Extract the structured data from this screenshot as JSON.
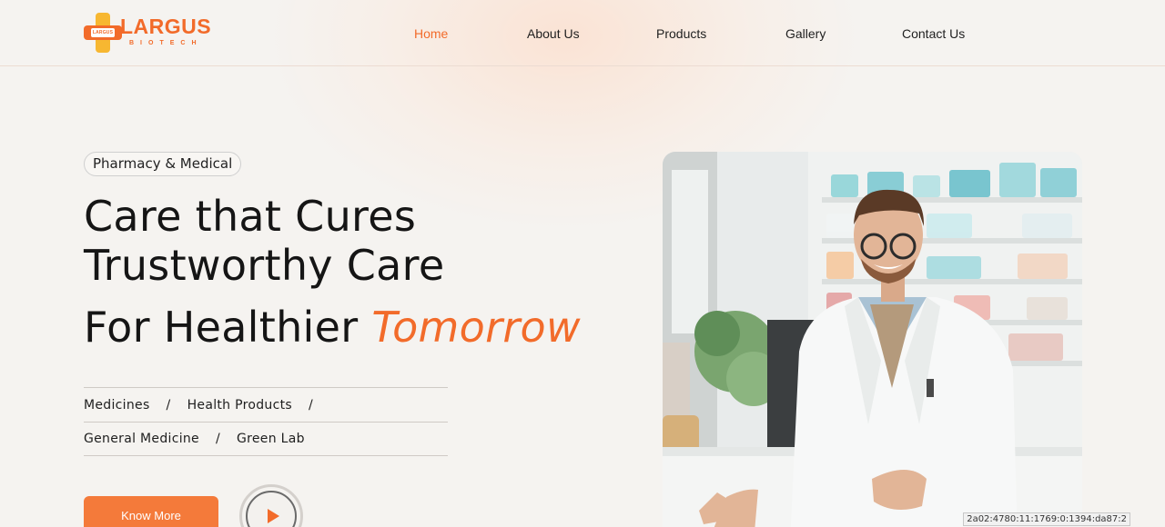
{
  "brand": {
    "name": "LARGUS",
    "subtitle": "BIOTECH",
    "mark_text": "LARGUS",
    "logo_icon": "cross-logo-icon"
  },
  "colors": {
    "accent": "#f26b2a",
    "accent_button": "#f47a3a",
    "logo_secondary": "#f7b731",
    "background": "#f5f3f0"
  },
  "nav": {
    "items": [
      {
        "label": "Home",
        "active": true
      },
      {
        "label": "About Us",
        "active": false
      },
      {
        "label": "Products",
        "active": false
      },
      {
        "label": "Gallery",
        "active": false
      },
      {
        "label": "Contact Us",
        "active": false
      }
    ]
  },
  "hero": {
    "tag": "Pharmacy & Medical",
    "title_line1": "Care that Cures",
    "title_line2": "Trustworthy Care",
    "title_line3_prefix": "For Healthier",
    "title_line3_accent": "Tomorrow",
    "services_row1": [
      "Medicines",
      "Health Products"
    ],
    "services_row2": [
      "General Medicine",
      "Green Lab"
    ],
    "separator": "/",
    "cta_label": "Know More",
    "play_icon": "play-icon",
    "image_description": "pharmacist-photo"
  },
  "footer_overlay": {
    "ip_text": "2a02:4780:11:1769:0:1394:da87:2"
  }
}
